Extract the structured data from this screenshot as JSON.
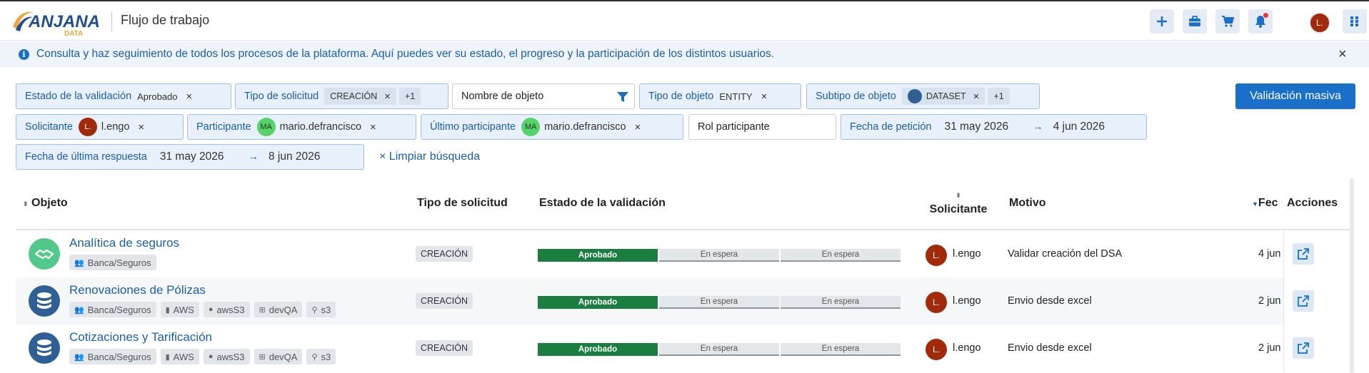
{
  "header": {
    "title": "Flujo de trabajo",
    "logo_text": "ANJANA",
    "logo_sub": "DATA",
    "user_initial": "L."
  },
  "banner": {
    "text": "Consulta y haz seguimiento de todos los procesos de la plataforma. Aquí puedes ver su estado, el progreso y la participación de los distintos usuarios.",
    "close": "×"
  },
  "filters": {
    "estado_label": "Estado de la validación",
    "estado_value": "Aprobado",
    "tipo_solicitud_label": "Tipo de solicitud",
    "tipo_solicitud_value": "CREACIÓN",
    "tipo_solicitud_more": "+1",
    "nombre_placeholder": "Nombre de objeto",
    "tipo_objeto_label": "Tipo de objeto",
    "tipo_objeto_value": "ENTITY",
    "subtipo_label": "Subtipo de objeto",
    "subtipo_value": "DATASET",
    "subtipo_more": "+1",
    "solicitante_label": "Solicitante",
    "solicitante_initial": "L.",
    "solicitante_value": "l.engo",
    "participante_label": "Participante",
    "participante_initial": "MA",
    "participante_value": "mario.defrancisco",
    "ultimo_label": "Último participante",
    "ultimo_initial": "MA",
    "ultimo_value": "mario.defrancisco",
    "rol_placeholder": "Rol participante",
    "fecha_peticion_label": "Fecha de petición",
    "fecha_peticion_from": "31 may 2026",
    "fecha_peticion_to": "4 jun 2026",
    "fecha_respuesta_label": "Fecha de última respuesta",
    "fecha_respuesta_from": "31 may 2026",
    "fecha_respuesta_to": "8 jun 2026",
    "clear_label": "Limpiar búsqueda",
    "mass_button": "Validación masiva"
  },
  "table": {
    "columns": {
      "objeto": "Objeto",
      "tipo": "Tipo de solicitud",
      "estado": "Estado de la validación",
      "solicitante": "Solicitante",
      "motivo": "Motivo",
      "fecha": "Fec",
      "acciones": "Acciones"
    },
    "rows": [
      {
        "name": "Analítica de seguros",
        "tags": [
          "Banca/Seguros"
        ],
        "tipo": "CREACIÓN",
        "status": [
          "Aprobado",
          "En espera",
          "En espera"
        ],
        "user_initial": "L.",
        "user": "l.engo",
        "motivo": "Validar creación del DSA",
        "fecha": "4 jun"
      },
      {
        "name": "Renovaciones de Pólizas",
        "tags": [
          "Banca/Seguros",
          "AWS",
          "awsS3",
          "devQA",
          "s3"
        ],
        "tipo": "CREACIÓN",
        "status": [
          "Aprobado",
          "En espera",
          "En espera"
        ],
        "user_initial": "L.",
        "user": "l.engo",
        "motivo": "Envio desde excel",
        "fecha": "2 jun"
      },
      {
        "name": "Cotizaciones y Tarificación",
        "tags": [
          "Banca/Seguros",
          "AWS",
          "awsS3",
          "devQA",
          "s3"
        ],
        "tipo": "CREACIÓN",
        "status": [
          "Aprobado",
          "En espera",
          "En espera"
        ],
        "user_initial": "L.",
        "user": "l.engo",
        "motivo": "Envio desde excel",
        "fecha": "2 jun"
      }
    ]
  },
  "colors": {
    "primary": "#1a6fc9",
    "approved": "#1a7f3e",
    "avatar": "#a12a0a"
  }
}
